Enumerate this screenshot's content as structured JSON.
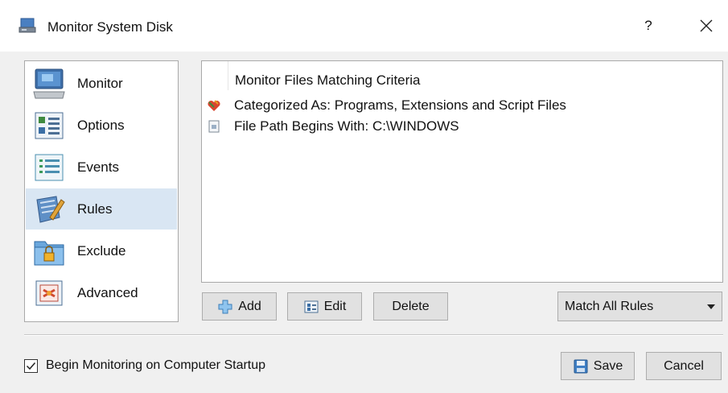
{
  "window": {
    "title": "Monitor System Disk",
    "help_glyph": "?",
    "close_glyph": "✕"
  },
  "sidebar": {
    "items": [
      {
        "label": "Monitor",
        "icon": "monitor-icon",
        "selected": false
      },
      {
        "label": "Options",
        "icon": "options-icon",
        "selected": false
      },
      {
        "label": "Events",
        "icon": "events-icon",
        "selected": false
      },
      {
        "label": "Rules",
        "icon": "rules-icon",
        "selected": true
      },
      {
        "label": "Exclude",
        "icon": "exclude-lock-folder-icon",
        "selected": false
      },
      {
        "label": "Advanced",
        "icon": "advanced-icon",
        "selected": false
      }
    ]
  },
  "rules": {
    "header": "Monitor Files Matching Criteria",
    "items": [
      {
        "text": "Categorized As: Programs, Extensions and Script Files",
        "icon": "category-heart-icon"
      },
      {
        "text": "File Path Begins With: C:\\WINDOWS",
        "icon": "file-path-icon"
      }
    ]
  },
  "buttons": {
    "add": "Add",
    "edit": "Edit",
    "delete": "Delete",
    "save": "Save",
    "cancel": "Cancel"
  },
  "match_select": {
    "value": "Match All Rules"
  },
  "startup_checkbox": {
    "label": "Begin Monitoring on Computer Startup",
    "checked": true
  },
  "colors": {
    "selected_bg": "#d9e6f3",
    "button_bg": "#e1e1e1",
    "window_bg": "#f0f0f0"
  }
}
